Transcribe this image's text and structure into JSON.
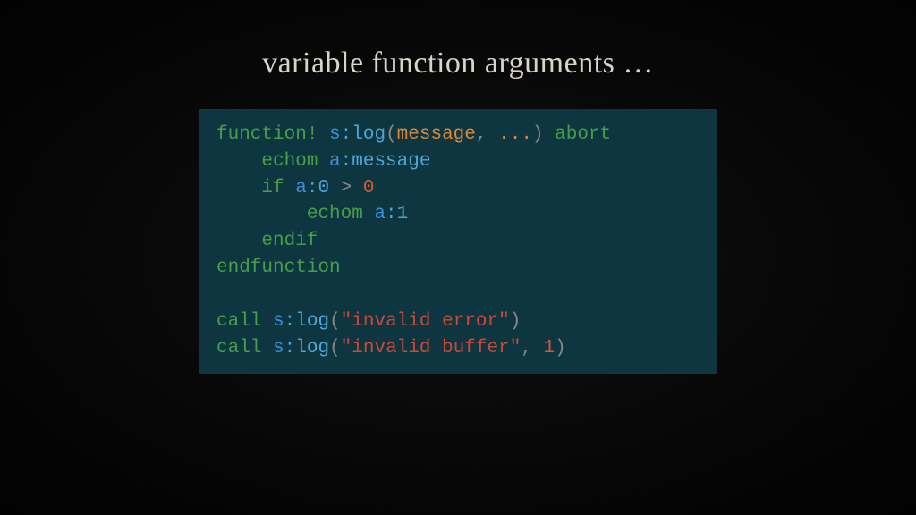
{
  "title": "variable function arguments …",
  "code": {
    "l1": {
      "t1": "function!",
      "t2": " s",
      "t3": ":log",
      "t4": "(",
      "t5": "message",
      "t6": ", ",
      "t7": "...",
      "t8": ")",
      "t9": " abort"
    },
    "l2": {
      "t1": "    echom",
      "t2": " a",
      "t3": ":message"
    },
    "l3": {
      "t1": "    if",
      "t2": " a",
      "t3": ":0",
      "t4": " > ",
      "t5": "0"
    },
    "l4": {
      "t1": "        echom",
      "t2": " a",
      "t3": ":1"
    },
    "l5": {
      "t1": "    endif"
    },
    "l6": {
      "t1": "endfunction"
    },
    "l7": {
      "t1": ""
    },
    "l8": {
      "t1": "call",
      "t2": " s",
      "t3": ":log",
      "t4": "(",
      "t5": "\"invalid error\"",
      "t6": ")"
    },
    "l9": {
      "t1": "call",
      "t2": " s",
      "t3": ":log",
      "t4": "(",
      "t5": "\"invalid buffer\"",
      "t6": ", ",
      "t7": "1",
      "t8": ")"
    }
  }
}
